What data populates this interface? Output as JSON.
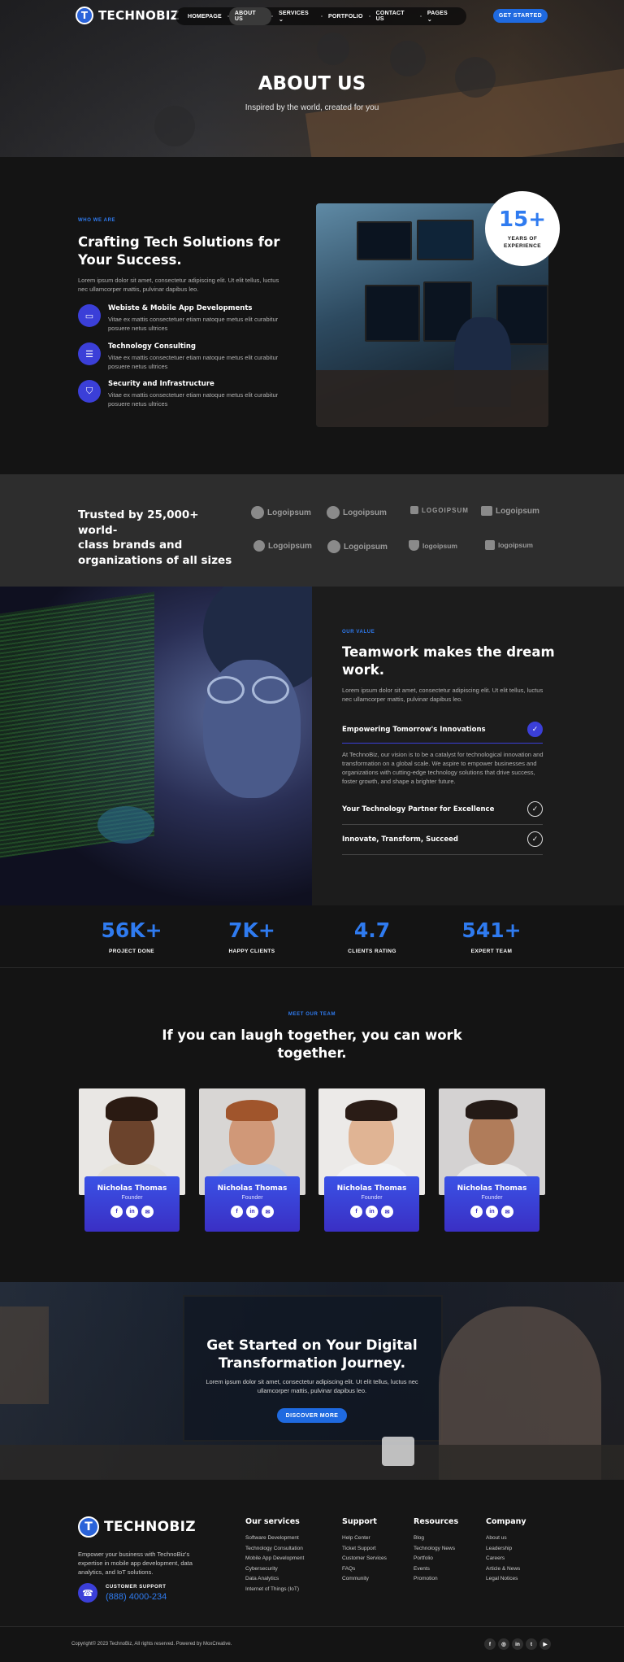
{
  "header": {
    "brand": "TECHNOBIZ",
    "nav": [
      "HOMEPAGE",
      "ABOUT US",
      "SERVICES",
      "PORTFOLIO",
      "CONTACT US",
      "PAGES"
    ],
    "cta": "GET STARTED"
  },
  "hero": {
    "title": "ABOUT US",
    "subtitle": "Inspired by the world, created for you"
  },
  "about": {
    "kicker": "WHO WE ARE",
    "title_l1": "Crafting Tech Solutions for",
    "title_l2": "Your Success.",
    "body": "Lorem ipsum dolor sit amet, consectetur adipiscing elit. Ut elit tellus, luctus nec ullamcorper mattis, pulvinar dapibus leo.",
    "features": [
      {
        "icon": "devices-icon",
        "title": "Webiste & Mobile App Developments",
        "text": "Vitae ex mattis consectetuer etiam natoque metus elit curabitur posuere netus ultrices"
      },
      {
        "icon": "chat-icon",
        "title": "Technology Consulting",
        "text": "Vitae ex mattis consectetuer etiam natoque metus elit curabitur posuere netus ultrices"
      },
      {
        "icon": "shield-icon",
        "title": "Security and Infrastructure",
        "text": "Vitae ex mattis consectetuer etiam natoque metus elit curabitur posuere netus ultrices"
      }
    ],
    "badge": {
      "number": "15+",
      "l1": "YEARS OF",
      "l2": "EXPERIENCE"
    }
  },
  "trusted": {
    "l1": "Trusted by 25,000+ world-",
    "l2": "class brands and",
    "l3": "organizations of all sizes",
    "logos": [
      "Logoipsum",
      "Logoipsum",
      "LOGOIPSUM",
      "Logoipsum",
      "Logoipsum",
      "Logoipsum",
      "logoipsum",
      "logoipsum"
    ]
  },
  "value": {
    "kicker": "OUR VALUE",
    "title_l1": "Teamwork makes the dream",
    "title_l2": "work.",
    "body": "Lorem ipsum dolor sit amet, consectetur adipiscing elit. Ut elit tellus, luctus nec ullamcorper mattis, pulvinar dapibus leo.",
    "items": [
      {
        "title": "Empowering Tomorrow's Innovations",
        "open": true
      },
      {
        "title": "Your Technology Partner for Excellence",
        "open": false
      },
      {
        "title": "Innovate, Transform, Succeed",
        "open": false
      }
    ],
    "open_text": "At TechnoBiz, our vision is to be a catalyst for technological innovation and transformation on a global scale. We aspire to empower businesses and organizations with cutting-edge technology solutions that drive success, foster growth, and shape a brighter future."
  },
  "stats": [
    {
      "value": "56K+",
      "label": "PROJECT DONE"
    },
    {
      "value": "7K+",
      "label": "HAPPY CLIENTS"
    },
    {
      "value": "4.7",
      "label": "CLIENTS RATING"
    },
    {
      "value": "541+",
      "label": "EXPERT TEAM"
    }
  ],
  "team": {
    "kicker": "MEET OUR TEAM",
    "title_l1": "If you can laugh together, you can work",
    "title_l2": "together.",
    "members": [
      {
        "name": "Nicholas Thomas",
        "role": "Founder"
      },
      {
        "name": "Nicholas Thomas",
        "role": "Founder"
      },
      {
        "name": "Nicholas Thomas",
        "role": "Founder"
      },
      {
        "name": "Nicholas Thomas",
        "role": "Founder"
      }
    ],
    "social": [
      "f",
      "in",
      "✉"
    ]
  },
  "cta": {
    "title_l1": "Get Started on Your Digital",
    "title_l2": "Transformation Journey.",
    "body": "Lorem ipsum dolor sit amet, consectetur adipiscing elit. Ut elit tellus, luctus nec ullamcorper mattis, pulvinar dapibus leo.",
    "button": "DISCOVER MORE"
  },
  "footer": {
    "brand": "TECHNOBIZ",
    "about": "Empower your business with TechnoBiz's expertise in mobile app development, data analytics, and IoT solutions.",
    "support_label": "CUSTOMER SUPPORT",
    "phone": "(888) 4000-234",
    "columns": [
      {
        "title": "Our services",
        "links": [
          "Software Development",
          "Technology Consultation",
          "Mobile App Development",
          "Cybersecurity",
          "Data Analytics",
          "Internet of Things (IoT)"
        ]
      },
      {
        "title": "Support",
        "links": [
          "Help Center",
          "Ticket Support",
          "Customer Services",
          "FAQs",
          "Community"
        ]
      },
      {
        "title": "Resources",
        "links": [
          "Blog",
          "Technology News",
          "Portfolio",
          "Events",
          "Promotion"
        ]
      },
      {
        "title": "Company",
        "links": [
          "About us",
          "Leadership",
          "Careers",
          "Article & News",
          "Legal Notices"
        ]
      }
    ],
    "copyright": "Copyright© 2023 TechnoBiz, All rights reserved. Powered by MoxCreative.",
    "social": [
      "f",
      "◎",
      "in",
      "t",
      "▶"
    ]
  },
  "colors": {
    "accent": "#2f7bf0",
    "purple": "#3b3fd8",
    "bg": "#141414"
  }
}
